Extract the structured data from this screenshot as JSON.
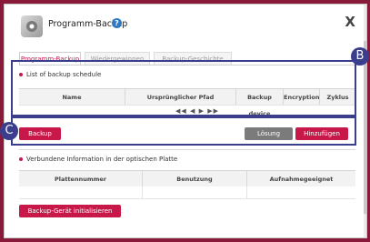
{
  "window": {
    "title": "Programm-Backup",
    "close_label": "X",
    "help_label": "?"
  },
  "tabs": [
    {
      "label": "Programm-Backup",
      "active": true
    },
    {
      "label": "Wiedergewinnen",
      "active": false
    },
    {
      "label": "Backup-Geschichte",
      "active": false
    }
  ],
  "schedule": {
    "heading": "List of backup schedule",
    "columns": [
      "Name",
      "Ursprünglicher Pfad",
      "Backup device",
      "Encryption",
      "Zyklus"
    ],
    "pager": "◀◀ ◀ ▶ ▶▶"
  },
  "actions": {
    "backup_label": "Backup",
    "delete_label": "Lösung",
    "add_label": "Hinzufügen"
  },
  "optical": {
    "heading": "Verbundene Information in der optischen Platte",
    "columns": [
      "Plattennummer",
      "Benutzung",
      "Aufnahmegeeignet"
    ],
    "init_label": "Backup-Gerät initialisieren"
  },
  "annotations": {
    "b_label": "B",
    "c_label": "C"
  },
  "colors": {
    "accent": "#c8184a",
    "annotation": "#3b3e8c",
    "grey_button": "#7b7b7b"
  }
}
